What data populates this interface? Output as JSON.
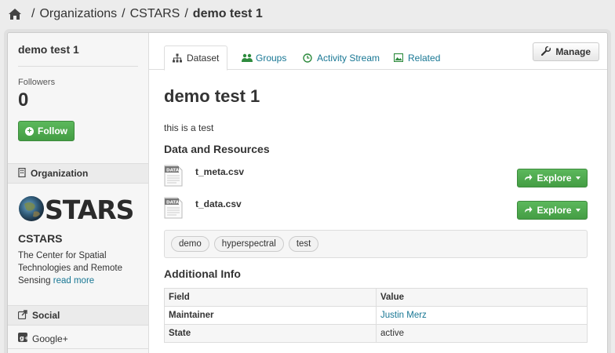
{
  "breadcrumb": {
    "home_icon": "home-icon",
    "separator": "/",
    "items": [
      "Organizations",
      "CSTARS",
      "demo test 1"
    ]
  },
  "sidebar": {
    "title": "demo test 1",
    "followers_label": "Followers",
    "followers_count": "0",
    "follow_label": "Follow",
    "organization_heading": "Organization",
    "org_logo_text": "CSTARS",
    "org_name": "CSTARS",
    "org_description": "The Center for Spatial Technologies and Remote Sensing",
    "read_more": "read more",
    "social_heading": "Social",
    "social_items": [
      "Google+"
    ]
  },
  "tabs": [
    {
      "label": "Dataset",
      "icon": "sitemap-icon",
      "active": true
    },
    {
      "label": "Groups",
      "icon": "users-icon",
      "active": false
    },
    {
      "label": "Activity Stream",
      "icon": "clock-icon",
      "active": false
    },
    {
      "label": "Related",
      "icon": "picture-icon",
      "active": false
    }
  ],
  "manage_label": "Manage",
  "dataset": {
    "title": "demo test 1",
    "notes": "this is a test",
    "resources_heading": "Data and Resources",
    "resources": [
      {
        "name": "t_meta.csv",
        "icon_label": "DATA",
        "action": "Explore"
      },
      {
        "name": "t_data.csv",
        "icon_label": "DATA",
        "action": "Explore"
      }
    ],
    "tags": [
      "demo",
      "hyperspectral",
      "test"
    ],
    "additional_info_heading": "Additional Info",
    "info_table": {
      "headers": [
        "Field",
        "Value"
      ],
      "rows": [
        {
          "field": "Maintainer",
          "value": "Justin Merz"
        },
        {
          "field": "State",
          "value": "active"
        }
      ]
    }
  },
  "colors": {
    "accent_green": "#449d44",
    "link_teal": "#187794",
    "page_bg": "#ececec"
  }
}
